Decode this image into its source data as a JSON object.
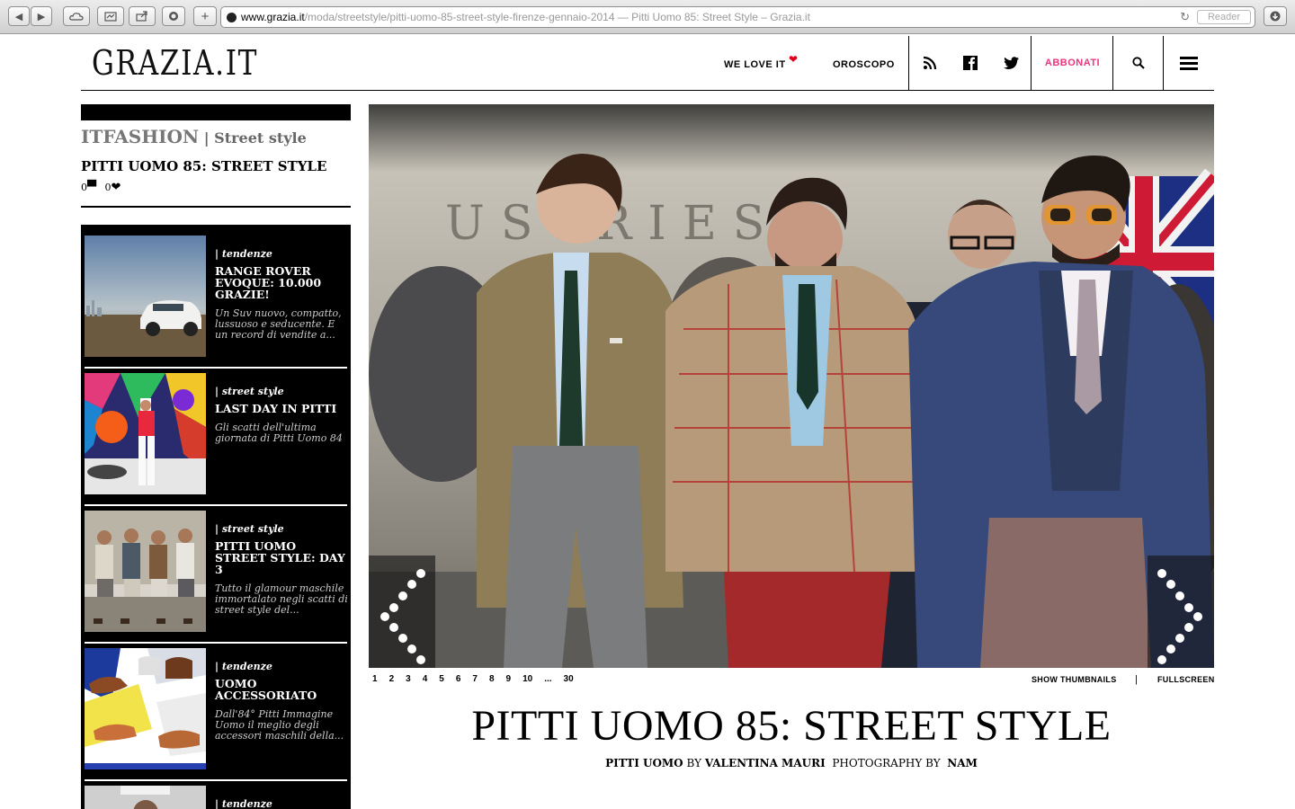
{
  "browser": {
    "url_domain": "www.grazia.it",
    "url_path": "/moda/streetstyle/pitti-uomo-85-street-style-firenze-gennaio-2014",
    "page_title_suffix": " — Pitti Uomo 85: Street Style – Grazia.it",
    "reader_label": "Reader"
  },
  "header": {
    "logo": "GRAZIA.IT",
    "we_love_it": "WE LOVE IT",
    "oroscopo": "OROSCOPO",
    "abbonati": "ABBONATI"
  },
  "sidebar": {
    "section_name": "ITFASHION",
    "section_sep": " | ",
    "section_sub": "Street style",
    "title": "PITTI UOMO 85: STREET STYLE",
    "comment_count": "0",
    "like_count": "0",
    "related": [
      {
        "category": "| tendenze",
        "title": "RANGE ROVER EVOQUE: 10.000 GRAZIE!",
        "desc": "Un Suv nuovo, compatto, lussuoso e seducente. E un record di vendite a..."
      },
      {
        "category": "| street style",
        "title": "LAST DAY IN PITTI",
        "desc": "Gli scatti dell'ultima giornata di Pitti Uomo 84"
      },
      {
        "category": "| street style",
        "title": "PITTI UOMO STREET STYLE: DAY 3",
        "desc": "Tutto il glamour maschile immortalato negli scatti di street style del..."
      },
      {
        "category": "| tendenze",
        "title": "UOMO ACCESSORIATO",
        "desc": "Dall'84° Pitti Immagine Uomo il meglio degli accessori maschili della..."
      },
      {
        "category": "| tendenze",
        "title": "",
        "desc": ""
      }
    ]
  },
  "gallery": {
    "pages": [
      "1",
      "2",
      "3",
      "4",
      "5",
      "6",
      "7",
      "8",
      "9",
      "10",
      "...",
      "30"
    ],
    "show_thumbnails": "SHOW THUMBNAILS",
    "separator": "|",
    "fullscreen": "FULLSCREEN"
  },
  "article": {
    "title": "PITTI UOMO 85: STREET STYLE",
    "category": "PITTI UOMO",
    "by_label": " BY ",
    "author": "VALENTINA MAURI",
    "photo_label": "PHOTOGRAPHY BY",
    "photographer": "NAM"
  }
}
